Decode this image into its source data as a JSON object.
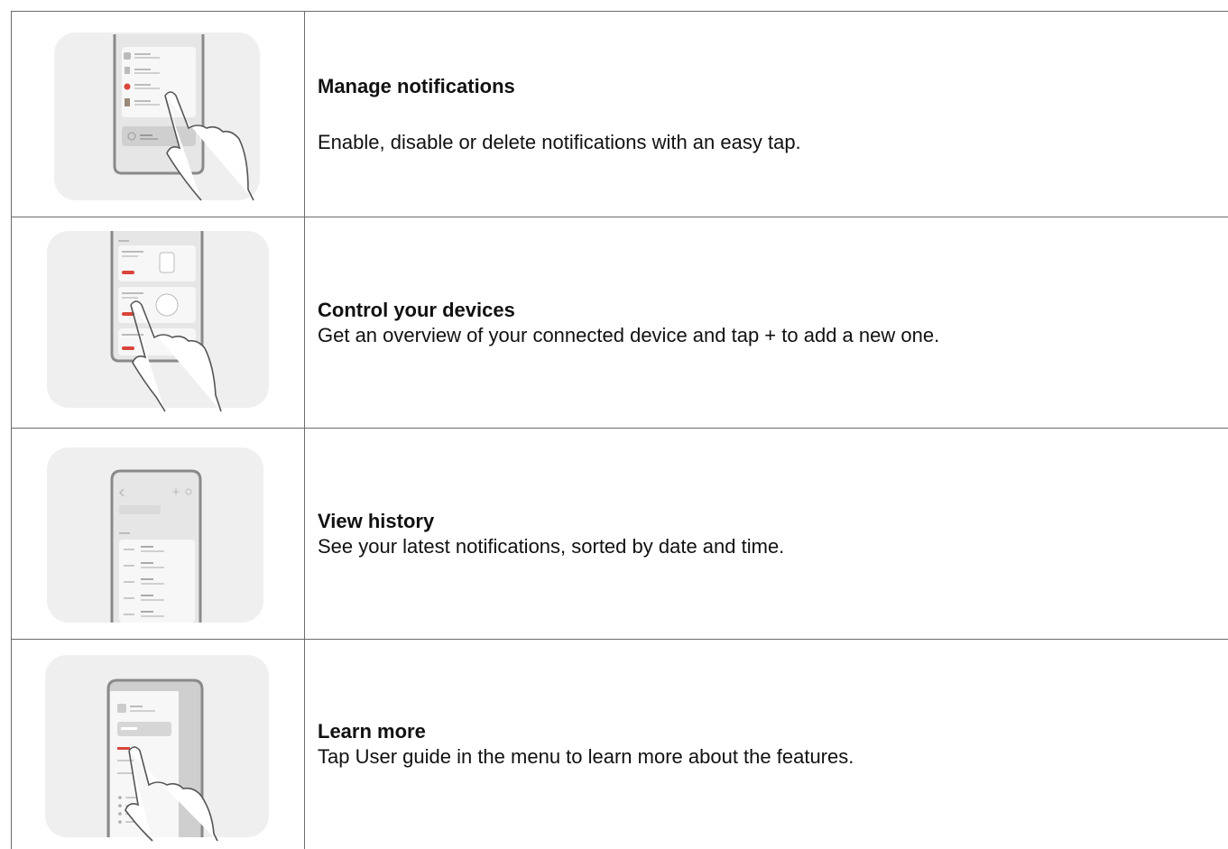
{
  "features": [
    {
      "title": "Manage notifications",
      "description": "Enable, disable or delete notifications with an easy tap.",
      "illustration": "phone-notifications-tap-icon"
    },
    {
      "title": "Control your devices",
      "description": "Get an overview of your connected device and tap + to add a new one.",
      "illustration": "phone-devices-tap-icon"
    },
    {
      "title": "View history",
      "description": "See your latest notifications, sorted by date and time.",
      "illustration": "phone-history-icon"
    },
    {
      "title": "Learn more",
      "description": "Tap User guide in the menu to learn more about the features.",
      "illustration": "phone-menu-tap-icon"
    }
  ],
  "colors": {
    "border": "#6b6b6b",
    "illustration_bg": "#efefef",
    "phone_frame": "#8a8a8a",
    "accent_red": "#d9453a"
  }
}
